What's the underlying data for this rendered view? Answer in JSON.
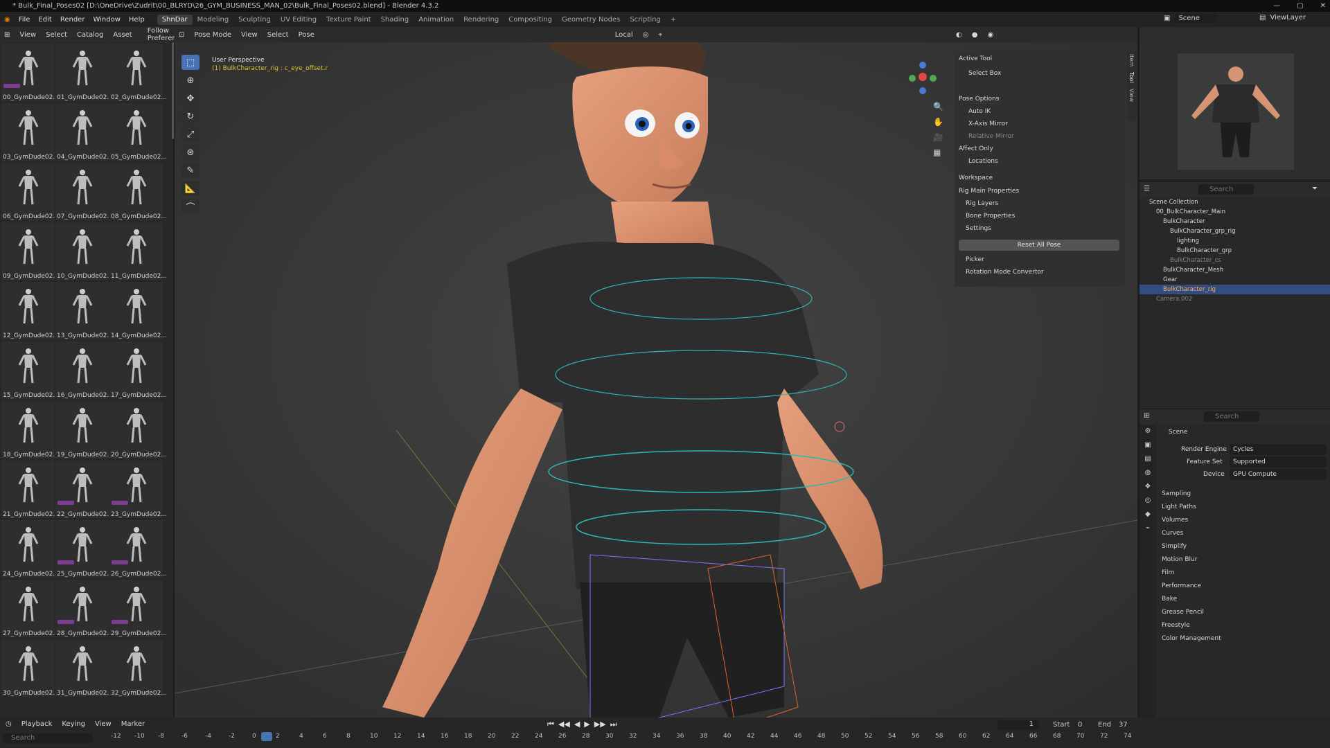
{
  "window": {
    "title": "* Bulk_Final_Poses02 [D:\\OneDrive\\Zudrit\\00_BLRYD\\26_GYM_BUSINESS_MAN_02\\Bulk_Final_Poses02.blend] - Blender 4.3.2"
  },
  "menu": {
    "items": [
      "File",
      "Edit",
      "Render",
      "Window",
      "Help"
    ],
    "workspaces": [
      "ShnDar",
      "Modeling",
      "Sculpting",
      "UV Editing",
      "Texture Paint",
      "Shading",
      "Animation",
      "Rendering",
      "Compositing",
      "Geometry Nodes",
      "Scripting",
      "+"
    ],
    "active_workspace": "ShnDar",
    "scene": "Scene",
    "view_layer": "ViewLayer"
  },
  "asset_header": {
    "items": [
      "View",
      "Select",
      "Catalog",
      "Asset"
    ],
    "follow": "Follow Preferer"
  },
  "asset_thumbs": [
    "00_GymDude02...",
    "01_GymDude02...",
    "02_GymDude02...",
    "03_GymDude02...",
    "04_GymDude02...",
    "05_GymDude02...",
    "06_GymDude02...",
    "07_GymDude02...",
    "08_GymDude02...",
    "09_GymDude02...",
    "10_GymDude02...",
    "11_GymDude02...",
    "12_GymDude02...",
    "13_GymDude02...",
    "14_GymDude02...",
    "15_GymDude02...",
    "16_GymDude02...",
    "17_GymDude02...",
    "18_GymDude02...",
    "19_GymDude02...",
    "20_GymDude02...",
    "21_GymDude02...",
    "22_GymDude02...",
    "23_GymDude02...",
    "24_GymDude02...",
    "25_GymDude02...",
    "26_GymDude02...",
    "27_GymDude02...",
    "28_GymDude02...",
    "29_GymDude02...",
    "30_GymDude02...",
    "31_GymDude02...",
    "32_GymDude02..."
  ],
  "vp_header": {
    "mode": "Pose Mode",
    "items": [
      "View",
      "Select",
      "Pose"
    ],
    "orientation": "Local",
    "pose_options": "Pose Options"
  },
  "viewport": {
    "label": "User Perspective",
    "sub": "(1) BulkCharacter_rig : c_eye_offset.r"
  },
  "npanel": {
    "active_tool": "Active Tool",
    "select_box": "Select Box",
    "pose_options": "Pose Options",
    "auto_ik": "Auto IK",
    "x_mirror": "X-Axis Mirror",
    "rel_mirror": "Relative Mirror",
    "affect_only": "Affect Only",
    "locations": "Locations",
    "workspace": "Workspace",
    "rig_main": "Rig Main Properties",
    "rig_layers": "Rig Layers",
    "bone_props": "Bone Properties",
    "settings": "Settings",
    "reset": "Reset All Pose",
    "picker": "Picker",
    "rotation": "Rotation Mode Convertor",
    "tabs": [
      "Item",
      "Tool",
      "View"
    ]
  },
  "outliner": {
    "search": "Search",
    "rows": [
      "Scene Collection",
      "00_BulkCharacter_Main",
      "BulkCharacter",
      "BulkCharacter_grp_rig",
      "lighting",
      "BulkCharacter_grp",
      "BulkCharacter_cs",
      "BulkCharacter_Mesh",
      "Gear",
      "BulkCharacter_rig",
      "Camera.002"
    ]
  },
  "props": {
    "search": "Search",
    "scene": "Scene",
    "render_engine_label": "Render Engine",
    "render_engine": "Cycles",
    "feature_set_label": "Feature Set",
    "feature_set": "Supported",
    "device_label": "Device",
    "device": "GPU Compute",
    "sections": [
      "Sampling",
      "Light Paths",
      "Volumes",
      "Curves",
      "Simplify",
      "Motion Blur",
      "Film",
      "Performance",
      "Bake",
      "Grease Pencil",
      "Freestyle",
      "Color Management"
    ]
  },
  "timeline": {
    "items": [
      "Playback",
      "Keying",
      "View",
      "Marker"
    ],
    "current": "1",
    "start_label": "Start",
    "start": "0",
    "end_label": "End",
    "end": "37",
    "search": "Search",
    "ticks": [
      "-12",
      "-10",
      "-8",
      "-6",
      "-4",
      "-2",
      "0",
      "2",
      "4",
      "6",
      "8",
      "10",
      "12",
      "14",
      "16",
      "18",
      "20",
      "22",
      "24",
      "26",
      "28",
      "30",
      "32",
      "34",
      "36",
      "38",
      "40",
      "42",
      "44",
      "46",
      "48",
      "50",
      "52",
      "54",
      "56",
      "58",
      "60",
      "62",
      "64",
      "66",
      "68",
      "70",
      "72",
      "74"
    ]
  }
}
